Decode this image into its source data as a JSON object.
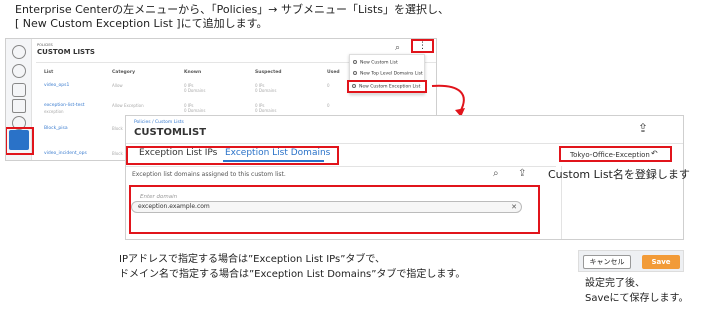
{
  "instruction": {
    "line1": "Enterprise Centerの左メニューから、「Policies」→ サブメニュー「Lists」を選択し、",
    "line2": "[ New Custom Exception List ]にて追加します。"
  },
  "shot1": {
    "breadcrumb": "POLICIES",
    "title": "CUSTOM LISTS",
    "columns": [
      "List",
      "Category",
      "Known",
      "Suspected",
      "Used"
    ],
    "rows": [
      {
        "list": "video_ops1",
        "sub": "",
        "category": "Allow",
        "known": "0 IPs\n0 Domains",
        "suspected": "0 IPs\n0 Domains",
        "used": "0"
      },
      {
        "list": "exception-list-test",
        "sub": "exception",
        "category": "Allow Exception",
        "known": "0 IPs\n0 Domains",
        "suspected": "0 IPs\n0 Domains",
        "used": "0"
      },
      {
        "list": "Block_pisa",
        "sub": "",
        "category": "Block",
        "known": "",
        "suspected": "",
        "used": "0"
      },
      {
        "list": "video_incident_ops",
        "sub": "",
        "category": "Block",
        "known": "0 IPs\n0 Domains",
        "suspected": "0 IPs",
        "used": "0"
      }
    ],
    "menu": [
      "New Custom List",
      "New Top Level Domains List",
      "New Custom Exception List"
    ]
  },
  "shot2": {
    "breadcrumb": "Policies / Custom Lists",
    "title": "CUSTOMLIST",
    "tabs": [
      "Exception List IPs",
      "Exception List Domains"
    ],
    "list_name": "Tokyo-Office-Exception",
    "description": "Exception list domains assigned to this custom list.",
    "domain_placeholder": "Enter domain",
    "domain_value": "exception.example.com"
  },
  "notes": {
    "custom_name": "Custom List名を登録します",
    "tabs_note1": "IPアドレスで指定する場合は”Exception List IPs”タブで、",
    "tabs_note2": "ドメイン名で指定する場合は”Exception List Domains”タブで指定します。",
    "save_note1": "設定完了後、",
    "save_note2": "Saveにて保存します。"
  },
  "buttons": {
    "cancel": "キャンセル",
    "save": "Save"
  },
  "colors": {
    "highlight": "#e1141b",
    "accent": "#2a72c8",
    "save": "#f29b38"
  }
}
